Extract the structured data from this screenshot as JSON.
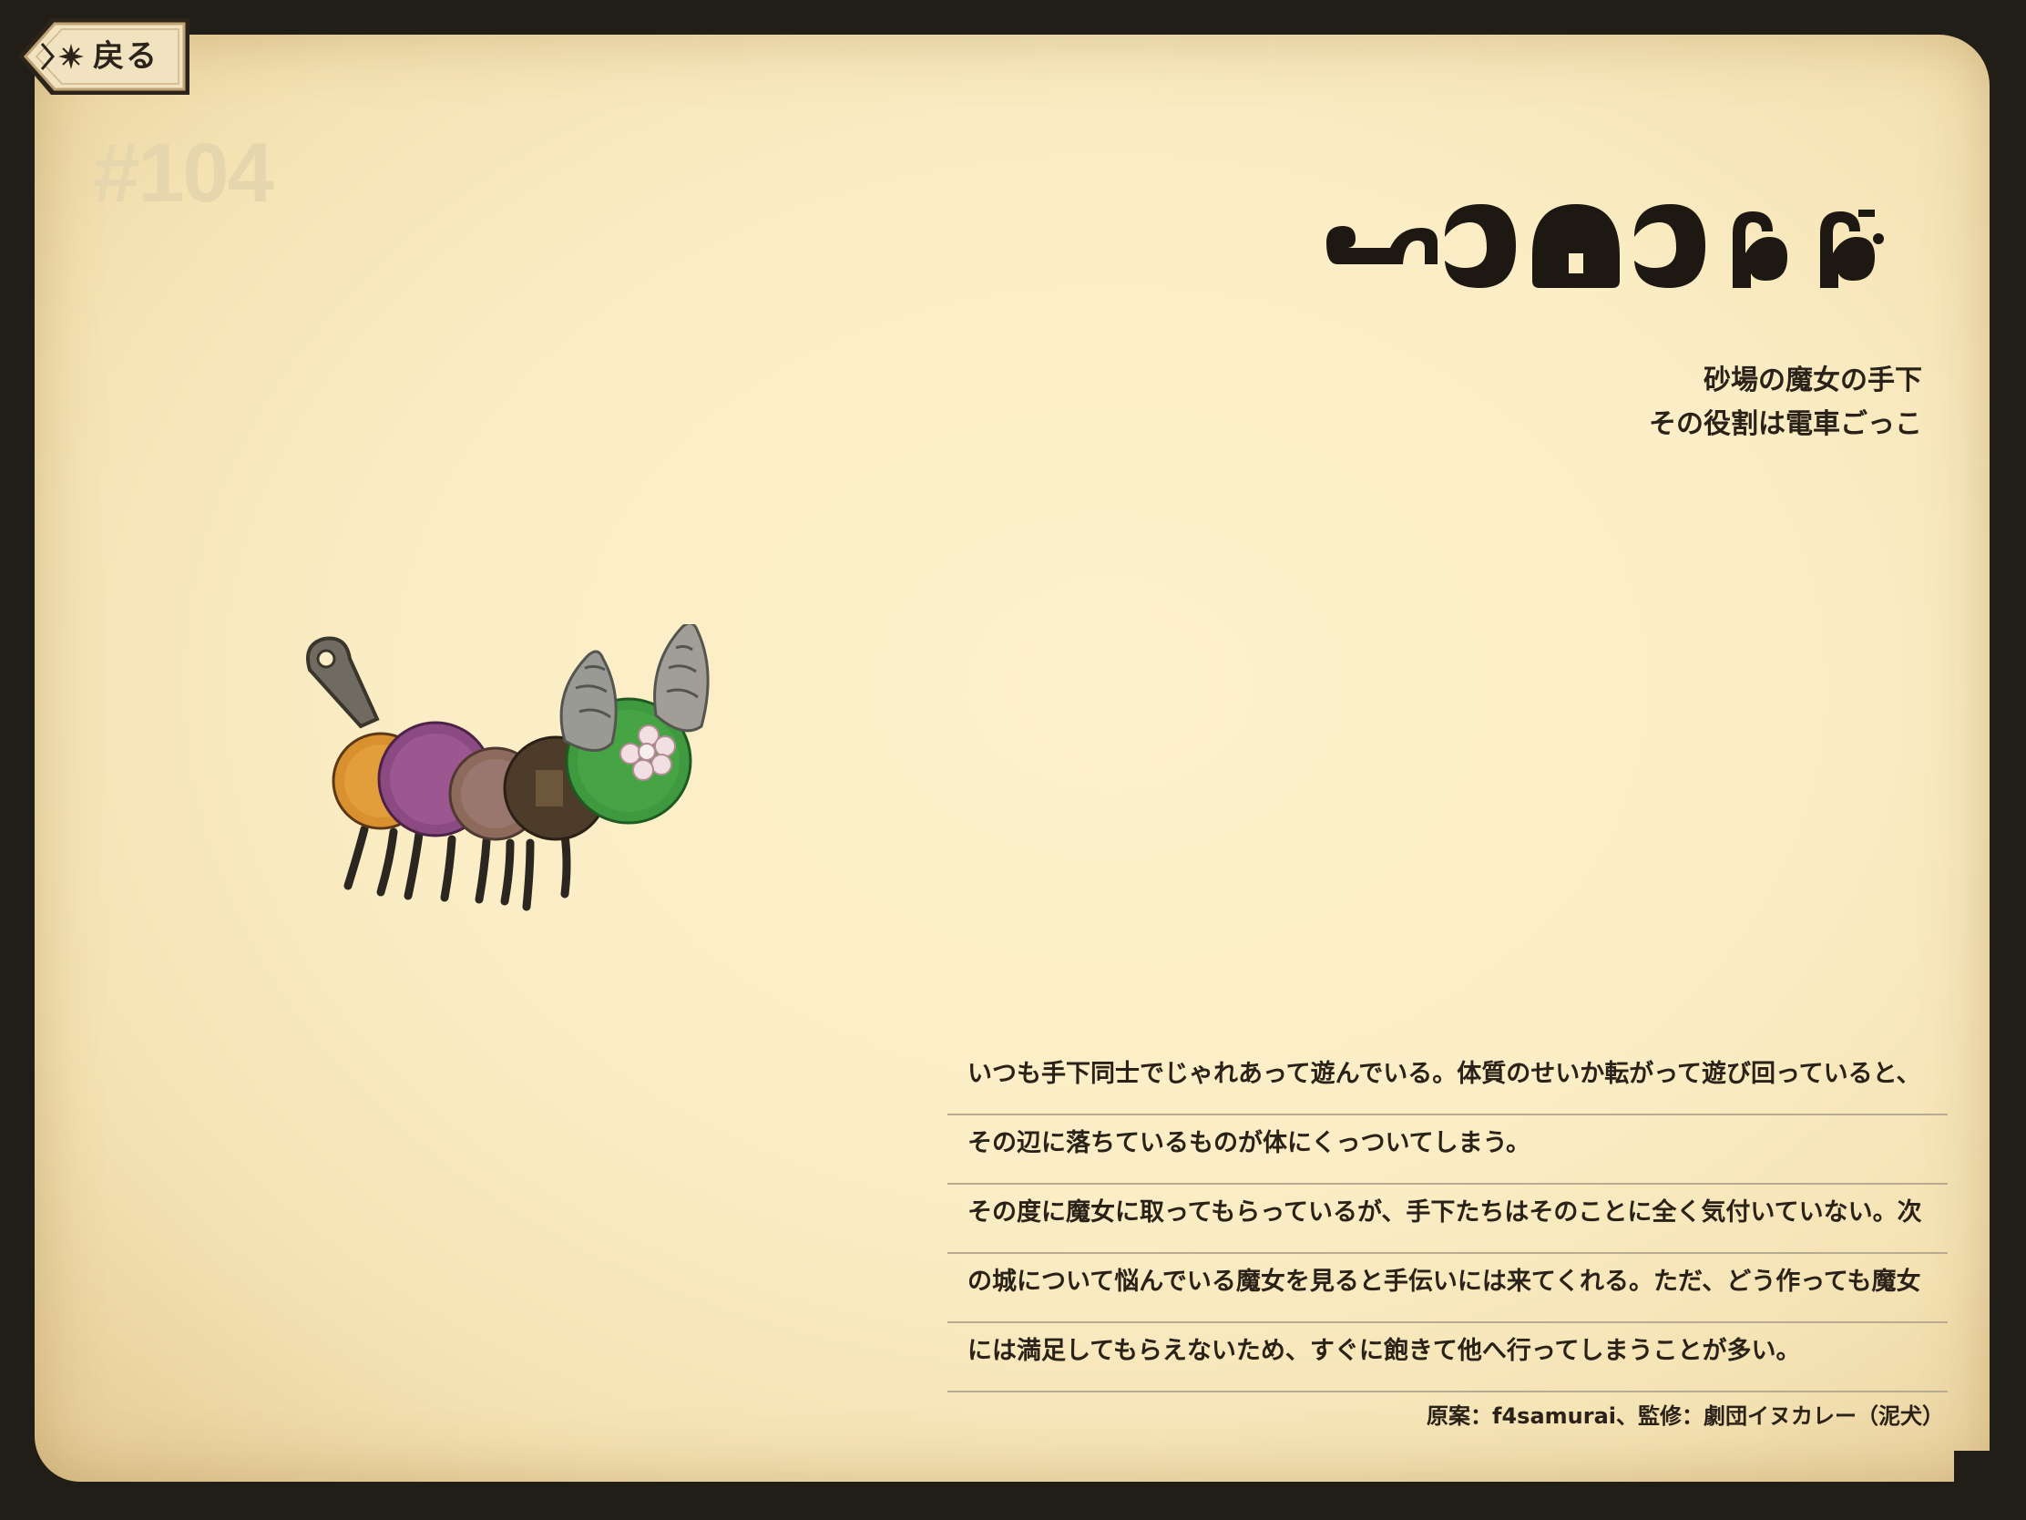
{
  "header": {
    "back_label": "戻る",
    "entry_number": "#104"
  },
  "entry": {
    "name": "ロタロタ",
    "subtitle_lines": [
      "砂場の魔女の手下",
      "その役割は電車ごっこ"
    ],
    "description_lines": [
      "いつも手下同士でじゃれあって遊んでいる。体質のせいか転がって遊び回っていると、",
      "その辺に落ちているものが体にくっついてしまう。",
      "その度に魔女に取ってもらっているが、手下たちはそのことに全く気付いていない。次",
      "の城について悩んでいる魔女を見ると手伝いには来てくれる。ただ、どう作っても魔女",
      "には満足してもらえないため、すぐに飽きて他へ行ってしまうことが多い。"
    ],
    "credit": "原案：f4samurai、監修：劇団イヌカレー（泥犬）"
  },
  "colors": {
    "frame": "#211d17",
    "page": "#fbeec6",
    "text": "#2a2218",
    "number": "#e6d6ad"
  }
}
